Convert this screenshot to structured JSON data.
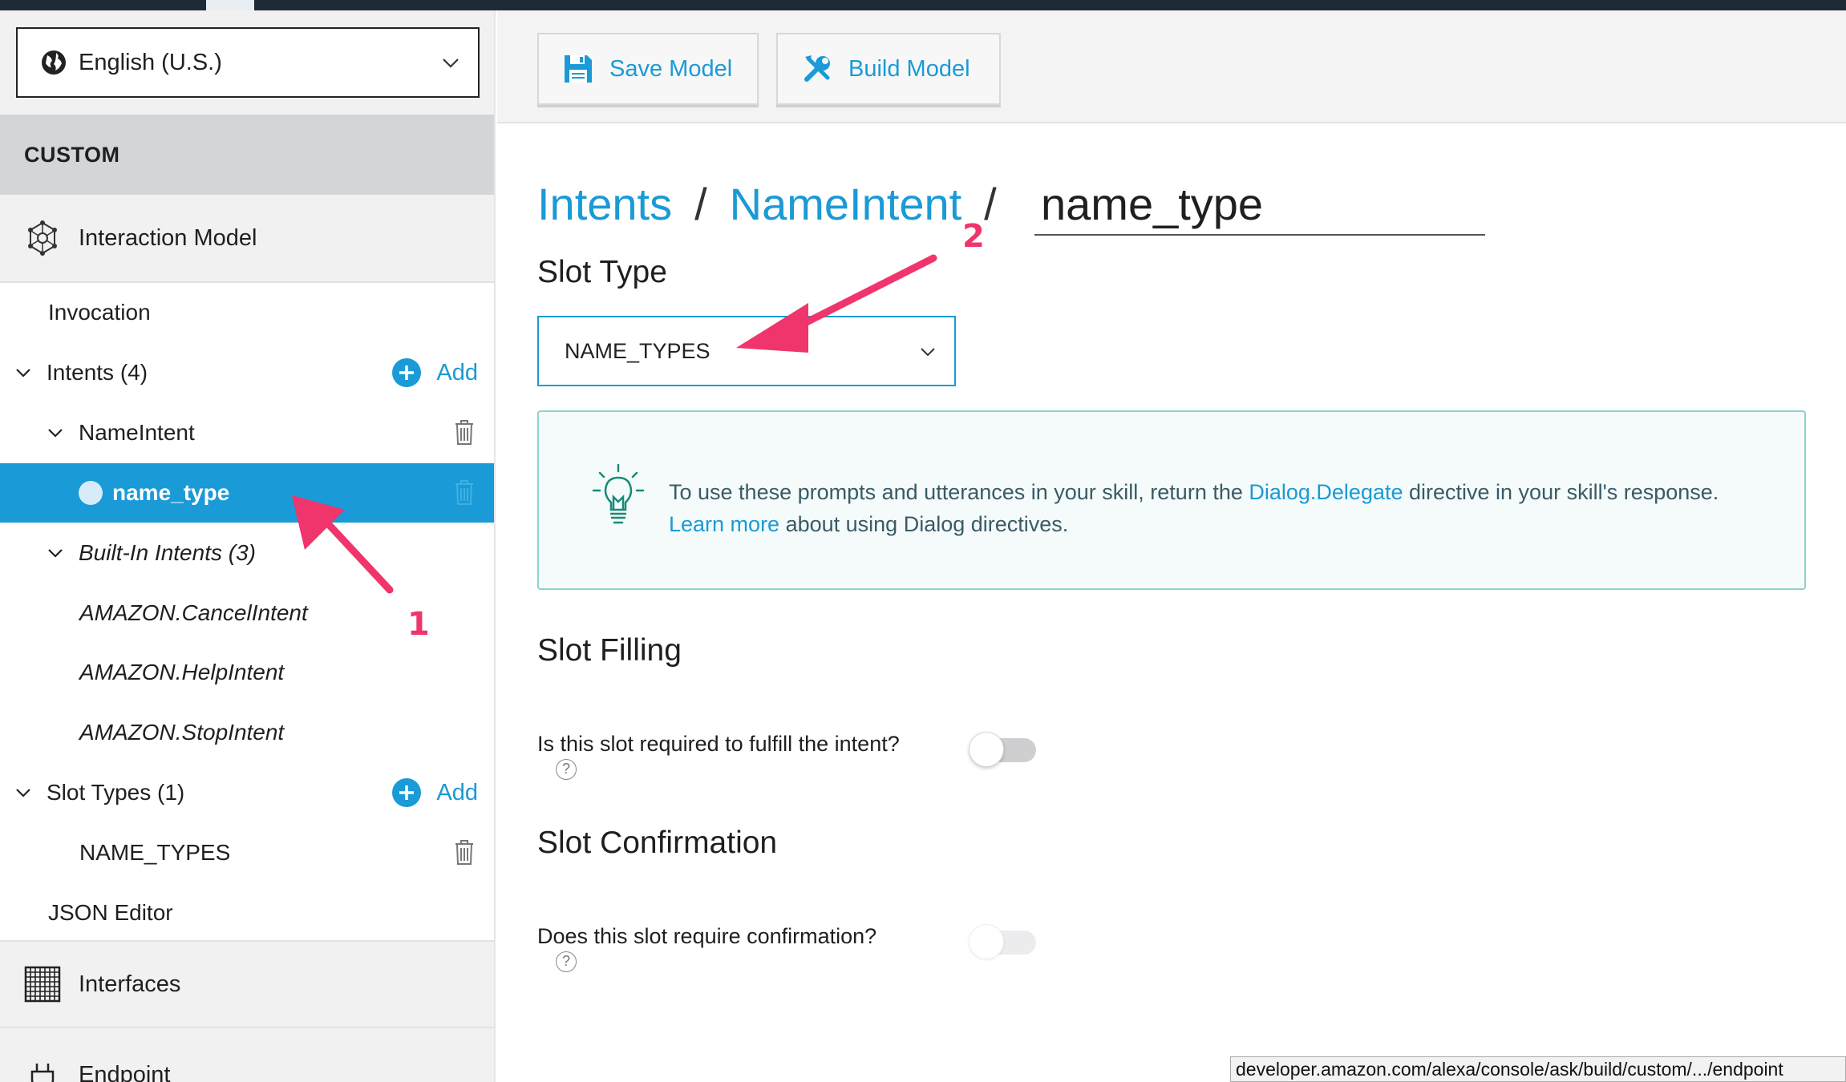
{
  "language": {
    "selected": "English (U.S.)"
  },
  "sidebar": {
    "custom_header": "CUSTOM",
    "interaction_model": "Interaction Model",
    "invocation": "Invocation",
    "intents": {
      "label": "Intents (4)",
      "add_label": "Add"
    },
    "name_intent": "NameIntent",
    "selected_slot": "name_type",
    "built_in": "Built-In Intents (3)",
    "built_in_items": [
      "AMAZON.CancelIntent",
      "AMAZON.HelpIntent",
      "AMAZON.StopIntent"
    ],
    "slot_types": {
      "label": "Slot Types (1)",
      "add_label": "Add"
    },
    "slot_type_item": "NAME_TYPES",
    "json_editor": "JSON Editor",
    "interfaces": "Interfaces",
    "endpoint": "Endpoint"
  },
  "toolbar": {
    "save_label": "Save Model",
    "build_label": "Build Model"
  },
  "breadcrumb": {
    "intents": "Intents",
    "sep": "/",
    "intent": "NameIntent",
    "current": "name_type"
  },
  "slot_type": {
    "heading": "Slot Type",
    "selected": "NAME_TYPES"
  },
  "info": {
    "text_1": "To use these prompts and utterances in your skill, return the ",
    "link_1": "Dialog.Delegate",
    "text_2": " directive in your skill's response.",
    "link_2": "Learn more",
    "text_3": " about using Dialog directives."
  },
  "slot_filling": {
    "heading": "Slot Filling",
    "question": "Is this slot required to fulfill the intent?",
    "help": "?",
    "enabled": false
  },
  "slot_confirmation": {
    "heading": "Slot Confirmation",
    "question": "Does this slot require confirmation?",
    "help": "?",
    "enabled": false
  },
  "status_url": "developer.amazon.com/alexa/console/ask/build/custom/.../endpoint",
  "annotations": {
    "one": "1",
    "two": "2"
  },
  "colors": {
    "accent": "#1a9ad6",
    "annotation": "#f0356c",
    "info_border": "#8fd3c8",
    "topbar": "#1f2a37"
  }
}
